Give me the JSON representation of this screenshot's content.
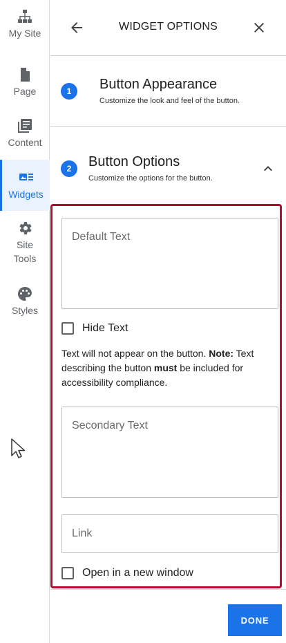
{
  "rail": {
    "items": [
      {
        "label": "My Site",
        "icon": "sitemap-icon"
      },
      {
        "label": "Page",
        "icon": "page-icon"
      },
      {
        "label": "Content",
        "icon": "content-icon"
      },
      {
        "label": "Widgets",
        "icon": "widgets-icon",
        "active": true
      },
      {
        "label": "Site Tools",
        "icon": "gear-icon"
      },
      {
        "label": "Styles",
        "icon": "palette-icon"
      }
    ]
  },
  "header": {
    "title": "WIDGET OPTIONS"
  },
  "steps": [
    {
      "number": "1",
      "title": "Button Appearance",
      "subtitle": "Customize the look and feel of the button."
    },
    {
      "number": "2",
      "title": "Button Options",
      "subtitle": "Customize the options for the button."
    }
  ],
  "options": {
    "default_text_placeholder": "Default Text",
    "hide_text_label": "Hide Text",
    "hint": {
      "part1": "Text will not appear on the button. ",
      "note": "Note:",
      "part2": " Text describing the button ",
      "must": "must",
      "part3": " be included for accessibility compliance."
    },
    "secondary_text_placeholder": "Secondary Text",
    "link_placeholder": "Link",
    "new_window_label": "Open in a new window"
  },
  "footer": {
    "done_label": "DONE"
  },
  "colors": {
    "accent": "#1a73e8",
    "highlight_border": "#b00d2f"
  }
}
